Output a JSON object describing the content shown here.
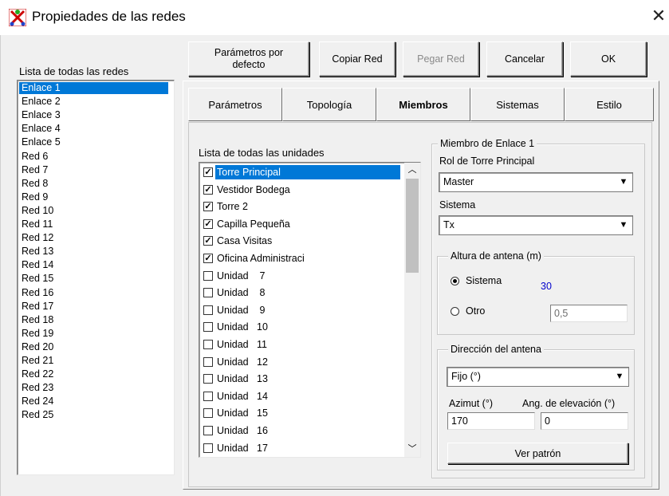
{
  "window": {
    "title": "Propiedades de las redes",
    "close_glyph": "✕"
  },
  "networks": {
    "label": "Lista de todas las redes",
    "items": [
      "Enlace 1",
      "Enlace 2",
      "Enlace 3",
      "Enlace 4",
      "Enlace 5",
      "Red  6",
      "Red  7",
      "Red  8",
      "Red  9",
      "Red 10",
      "Red 11",
      "Red 12",
      "Red 13",
      "Red 14",
      "Red 15",
      "Red 16",
      "Red 17",
      "Red 18",
      "Red 19",
      "Red 20",
      "Red 21",
      "Red 22",
      "Red 23",
      "Red 24",
      "Red 25"
    ],
    "selected": 0
  },
  "toolbar": {
    "defaults_l1": "Parámetros por",
    "defaults_l2": "defecto",
    "copy": "Copiar Red",
    "paste": "Pegar Red",
    "cancel": "Cancelar",
    "ok": "OK"
  },
  "tabs": [
    "Parámetros",
    "Topología",
    "Miembros",
    "Sistemas",
    "Estilo"
  ],
  "active_tab": 2,
  "units": {
    "label": "Lista de todas las unidades",
    "items": [
      {
        "name": "Torre Principal",
        "checked": true
      },
      {
        "name": "Vestidor Bodega",
        "checked": true
      },
      {
        "name": "Torre 2",
        "checked": true
      },
      {
        "name": "Capilla Pequeña",
        "checked": true
      },
      {
        "name": "Casa Visitas",
        "checked": true
      },
      {
        "name": "Oficina Administraci",
        "checked": true
      },
      {
        "name": "Unidad    7",
        "checked": false
      },
      {
        "name": "Unidad    8",
        "checked": false
      },
      {
        "name": "Unidad    9",
        "checked": false
      },
      {
        "name": "Unidad   10",
        "checked": false
      },
      {
        "name": "Unidad   11",
        "checked": false
      },
      {
        "name": "Unidad   12",
        "checked": false
      },
      {
        "name": "Unidad   13",
        "checked": false
      },
      {
        "name": "Unidad   14",
        "checked": false
      },
      {
        "name": "Unidad   15",
        "checked": false
      },
      {
        "name": "Unidad   16",
        "checked": false
      },
      {
        "name": "Unidad   17",
        "checked": false
      }
    ],
    "selected": 0
  },
  "member": {
    "group_title": "Miembro de Enlace 1",
    "role_label": "Rol de Torre Principal",
    "role_value": "Master",
    "system_label": "Sistema",
    "system_value": "Tx",
    "antenna_height": {
      "title": "Altura de antena (m)",
      "opt_system": "Sistema",
      "system_value": "30",
      "opt_other": "Otro",
      "other_value": "0,5"
    },
    "antenna_direction": {
      "title": "Dirección del antena",
      "mode_value": "Fijo (°)",
      "azimuth_label": "Azimut (°)",
      "elevation_label": "Ang. de elevación (°)",
      "azimuth_value": "170",
      "elevation_value": "0",
      "pattern_button": "Ver patrón"
    }
  },
  "colors": {
    "selection": "#0078d7",
    "value_blue": "#0000cc",
    "face": "#f0f0f0"
  }
}
